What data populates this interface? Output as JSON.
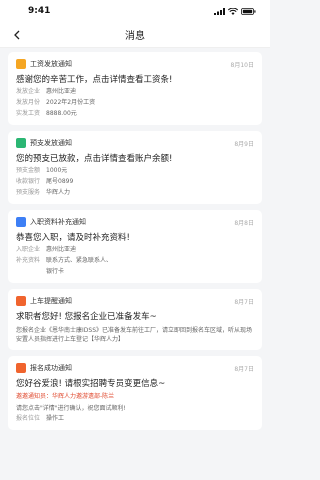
{
  "status_bar": {
    "time": "9:41"
  },
  "nav": {
    "title": "消息"
  },
  "cards": [
    {
      "type": "工资发放通知",
      "date": "8月10日",
      "icon_color": "#f5a623",
      "title": "感谢您的辛苦工作，点击详情查看工资条!",
      "rows": [
        {
          "label": "发放企业",
          "value": "惠州比亚迪"
        },
        {
          "label": "发放月份",
          "value": "2022年2月份工资"
        },
        {
          "label": "实发工资",
          "value": "8888.00元"
        }
      ]
    },
    {
      "type": "预支发放通知",
      "date": "8月9日",
      "icon_color": "#2bb673",
      "title": "您的预支已放款，点击详情查看账户余额!",
      "rows": [
        {
          "label": "预支金额",
          "value": "1000元"
        },
        {
          "label": "收款银行",
          "value": "尾号0899"
        },
        {
          "label": "预支服务",
          "value": "华辉人力"
        }
      ]
    },
    {
      "type": "入职资料补充通知",
      "date": "8月8日",
      "icon_color": "#3d7ff5",
      "title": "恭喜您入职，请及时补充资料!",
      "rows": [
        {
          "label": "入职企业",
          "value": "惠州比亚迪"
        },
        {
          "label": "补充资料",
          "value": "联系方式、紧急联系人、"
        },
        {
          "label": "",
          "value": "银行卡"
        }
      ]
    },
    {
      "type": "上车提醒通知",
      "date": "8月7日",
      "icon_color": "#f0642e",
      "title": "求职者您好! 您报名企业已准备发车~",
      "body": "您报名企业《恩华南士康IDSS》已准备发车前往工厂，请立即回到报名车区域，听从现场安置人员指挥进行上车登记【华辉人力】"
    },
    {
      "type": "报名成功通知",
      "date": "8月7日",
      "icon_color": "#f0642e",
      "title": "您好谷爱浪! 请根实招聘专员变更信息~",
      "red_line": "邀邀通知员：华辉人力邀游遗部-陈兰",
      "body": "请您点击\"详情\"进行确认，祝您面试顺利!",
      "rows": [
        {
          "label": "报名位位",
          "value": "操作工"
        }
      ]
    }
  ]
}
